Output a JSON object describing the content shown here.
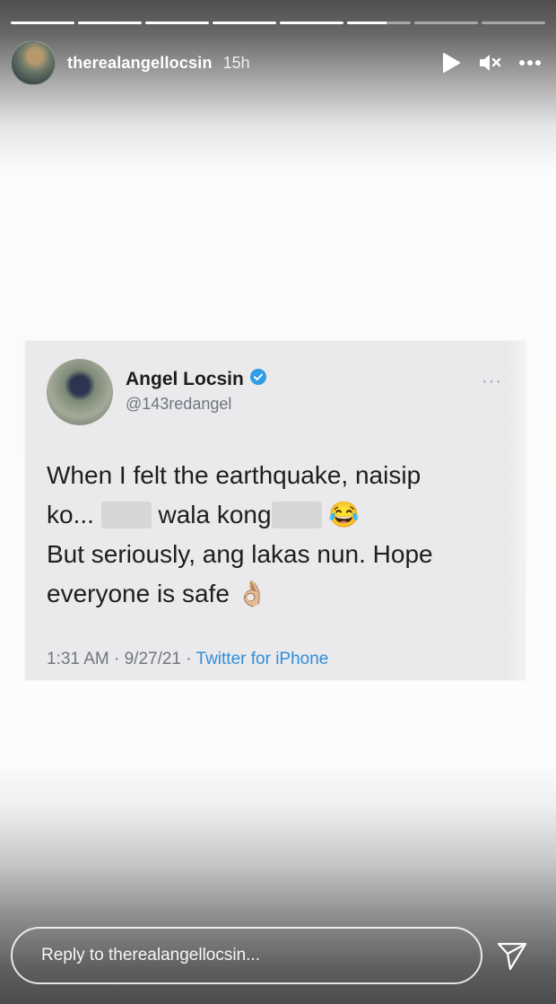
{
  "story": {
    "progress_segments": [
      1,
      1,
      1,
      1,
      1,
      0.62,
      0,
      0
    ],
    "username": "therealangellocsin",
    "time_ago": "15h",
    "icons": [
      "play-icon",
      "mute-icon",
      "more-icon"
    ]
  },
  "tweet": {
    "display_name": "Angel Locsin",
    "handle": "@143redangel",
    "line1": "When I felt the earthquake, naisip",
    "line2_a": "ko...",
    "line2_b": "wala kong",
    "emoji_1": "😂",
    "line3": "But seriously, ang lakas nun. Hope",
    "line4": "everyone is safe",
    "emoji_2": "👌🏼",
    "timestamp": "1:31 AM · 9/27/21 · ",
    "source": "Twitter for iPhone",
    "more": "···",
    "verified_color": "#2f9ce6"
  },
  "reply": {
    "placeholder": "Reply to therealangellocsin..."
  }
}
